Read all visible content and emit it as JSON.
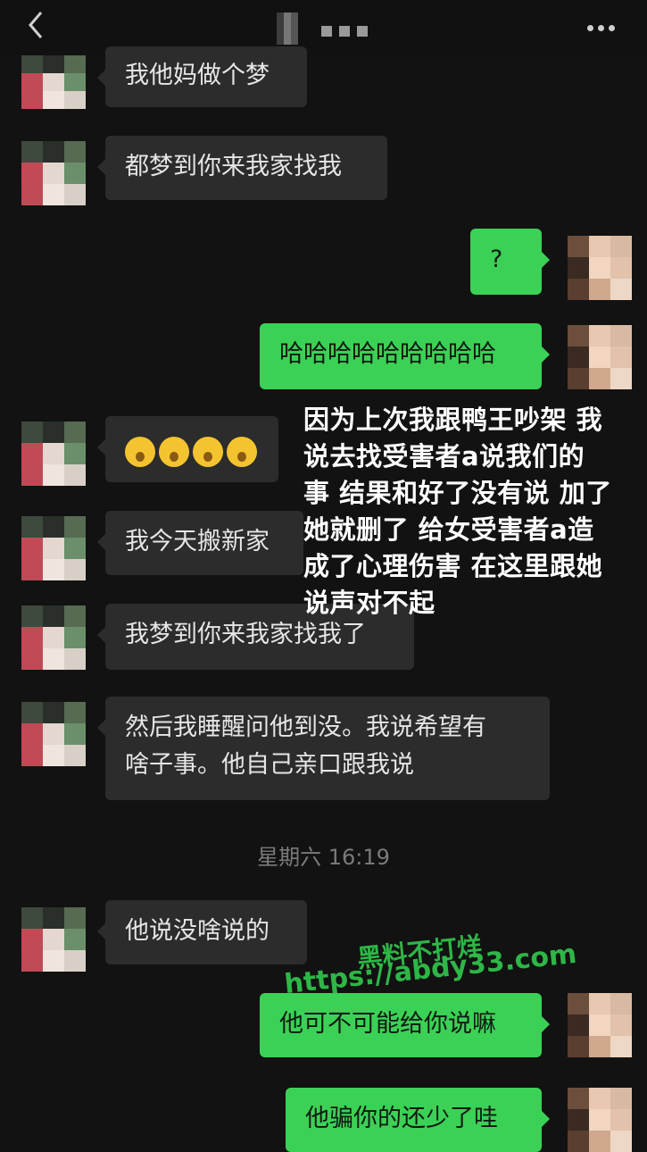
{
  "header": {
    "back_icon": "back-chevron-icon",
    "more_icon": "more-dots-icon"
  },
  "messages": [
    {
      "side": "left",
      "text": "我他妈做个梦"
    },
    {
      "side": "left",
      "text": "都梦到你来我家找我"
    },
    {
      "side": "right",
      "text": "?"
    },
    {
      "side": "right",
      "text": "哈哈哈哈哈哈哈哈哈"
    },
    {
      "side": "left",
      "emoji": "pleading-face-emoji",
      "emoji_count": 4
    },
    {
      "side": "left",
      "text": "我今天搬新家"
    },
    {
      "side": "left",
      "text": "我梦到你来我家找我了"
    },
    {
      "side": "left",
      "text": "然后我睡醒问他到没。我说希望有\n啥子事。他自己亲口跟我说"
    },
    {
      "side": "left",
      "text": "他说没啥说的"
    },
    {
      "side": "right",
      "text": "他可不可能给你说嘛"
    },
    {
      "side": "right",
      "text": "他骗你的还少了哇"
    }
  ],
  "timestamp": "星期六 16:19",
  "overlay_text": "因为上次我跟鸭王吵架 我\n说去找受害者a说我们的\n事 结果和好了没有说 加了\n她就删了 给女受害者a造\n成了心理伤害 在这里跟她\n说声对不起",
  "watermark": {
    "line1": "黑料不打烊",
    "line2": "https://abdy33.com"
  },
  "colors": {
    "background": "#121212",
    "incoming_bubble": "#2c2c2c",
    "outgoing_bubble": "#3bd156",
    "watermark": "#31c44c"
  }
}
